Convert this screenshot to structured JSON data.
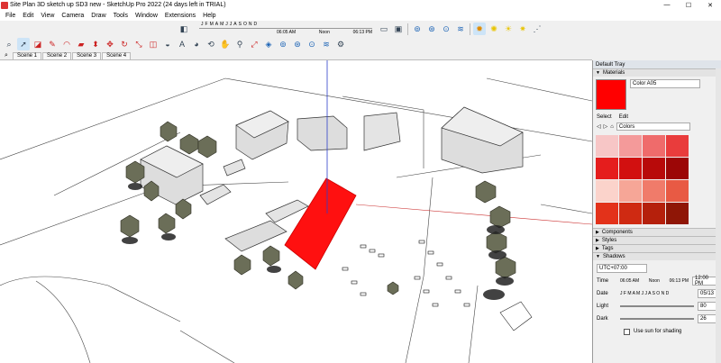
{
  "window": {
    "title": "Site Plan 3D sketch up SD3 new - SketchUp Pro 2022 (24 days left in TRIAL)",
    "min": "—",
    "max": "☐",
    "close": "✕"
  },
  "menu": [
    "File",
    "Edit",
    "View",
    "Camera",
    "Draw",
    "Tools",
    "Window",
    "Extensions",
    "Help"
  ],
  "shadow_toolbar": {
    "months": [
      "J",
      "F",
      "M",
      "A",
      "M",
      "J",
      "J",
      "A",
      "S",
      "O",
      "N",
      "D"
    ],
    "time_start": "06:05 AM",
    "time_mid": "Noon",
    "time_end": "06:13 PM"
  },
  "scenes": [
    "Scene 1",
    "Scene 2",
    "Scene 3",
    "Scene 4"
  ],
  "tray": {
    "title": "Default Tray",
    "materials": {
      "header": "Materials",
      "name": "Color A05",
      "tab_select": "Select",
      "tab_edit": "Edit",
      "collection": "Colors",
      "swatch_color": "#ff0000",
      "palette": [
        "#f7c6c6",
        "#f49a9a",
        "#ef6b6b",
        "#e93c3c",
        "#e51d1d",
        "#d21010",
        "#b80a0a",
        "#9c0606",
        "#fbd3cb",
        "#f6a697",
        "#f07b6a",
        "#e85a44",
        "#e3321a",
        "#cf2a12",
        "#b5200c",
        "#8f1606"
      ]
    },
    "collapsed": [
      "Components",
      "Styles",
      "Tags"
    ],
    "shadows": {
      "header": "Shadows",
      "utc": "UTC+07:00",
      "time_label": "Time",
      "time_start": "06:05 AM",
      "time_noon": "Noon",
      "time_end": "06:13 PM",
      "time_value": "12:00 PM",
      "date_label": "Date",
      "date_months": "J F M A M J J A S O N D",
      "date_value": "05/13",
      "light_label": "Light",
      "light_value": "80",
      "dark_label": "Dark",
      "dark_value": "26",
      "use_sun": "Use sun for shading"
    }
  }
}
